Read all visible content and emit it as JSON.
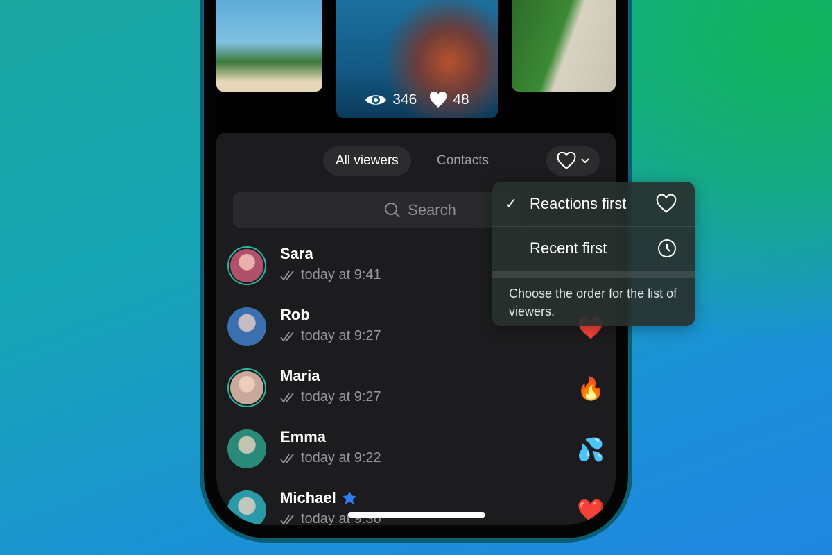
{
  "story": {
    "views": "346",
    "likes": "48",
    "views_icon": "eye-icon",
    "likes_icon": "heart-icon"
  },
  "tabs": [
    {
      "label": "All viewers",
      "selected": true
    },
    {
      "label": "Contacts",
      "selected": false
    }
  ],
  "sort_button": {
    "icon": "heart-icon",
    "chevron": "chevron-down-icon"
  },
  "search": {
    "placeholder": "Search"
  },
  "viewers": [
    {
      "name": "Sara",
      "time": "today at 9:41",
      "reaction": "",
      "avatar_color": "#b0506a",
      "ring": true
    },
    {
      "name": "Rob",
      "time": "today at 9:27",
      "reaction": "❤️",
      "avatar_color": "#3a6fb0",
      "ring": false
    },
    {
      "name": "Maria",
      "time": "today at 9:27",
      "reaction": "🔥",
      "avatar_color": "#c8a89a",
      "ring": true
    },
    {
      "name": "Emma",
      "time": "today at 9:22",
      "reaction": "💦",
      "avatar_color": "#2a8a7a",
      "ring": false
    },
    {
      "name": "Michael",
      "time": "today at 9:36",
      "reaction": "❤️",
      "avatar_color": "#2a9aa8",
      "ring": false,
      "premium": true
    }
  ],
  "sort_menu": {
    "items": [
      {
        "label": "Reactions first",
        "checked": true,
        "icon": "heart-icon"
      },
      {
        "label": "Recent first",
        "checked": false,
        "icon": "clock-icon"
      }
    ],
    "footer": "Choose the order for the list of viewers."
  },
  "colors": {
    "panel": "#1c1c1e",
    "accent_star": "#2f7cf6",
    "ring": "#2bb8a6"
  }
}
